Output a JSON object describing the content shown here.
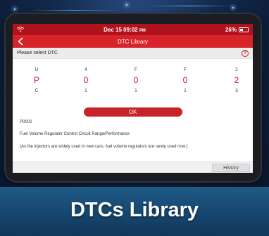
{
  "status": {
    "time": "Dec 15 09:02",
    "ampm": "PM",
    "battery": "26%"
  },
  "titlebar": {
    "title": "DTC Library"
  },
  "select": {
    "label": "Please select DTC",
    "help": "?"
  },
  "dtc": {
    "columns": [
      {
        "top": "U",
        "main": "P",
        "bottom": "C"
      },
      {
        "top": "4",
        "main": "0",
        "bottom": "1"
      },
      {
        "top": "F",
        "main": "0",
        "bottom": "1"
      },
      {
        "top": "F",
        "main": "0",
        "bottom": "1"
      },
      {
        "top": "1",
        "main": "2",
        "bottom": "3"
      }
    ]
  },
  "ok_label": "OK",
  "result": {
    "code": "P0002",
    "description": "Fuel Volume Regulator Control Circuit Range/Performance",
    "note": "(As the injectors are widely used in new cars, fuel volume regulators are rarely used now.)"
  },
  "history_label": "History",
  "banner": {
    "title": "DTCs Library"
  },
  "colors": {
    "brand_red": "#d9232b",
    "status_red": "#b0131b",
    "text_red": "#c62128"
  }
}
